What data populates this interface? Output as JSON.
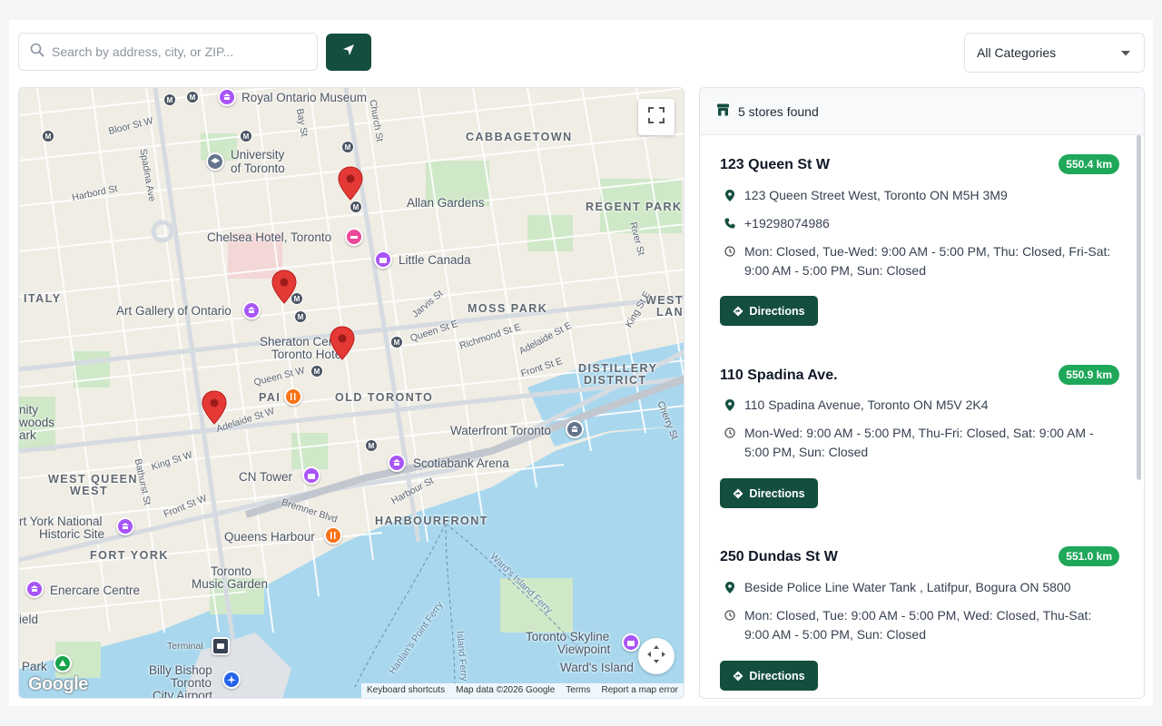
{
  "search": {
    "placeholder": "Search by address, city, or ZIP..."
  },
  "category": {
    "selected": "All Categories"
  },
  "map": {
    "labels": {
      "royal_ontario_museum": "Royal Ontario Museum",
      "university": "University",
      "of_toronto": "of Toronto",
      "cabbagetown": "CABBAGETOWN",
      "allan_gardens": "Allan Gardens",
      "regent_park": "REGENT PARK",
      "chelsea_hotel": "Chelsea Hotel, Toronto",
      "little_canada": "Little Canada",
      "italy": "ITALY",
      "art_gallery": "Art Gallery of Ontario",
      "moss_park": "MOSS PARK",
      "west_lan": "WEST",
      "west_lan2": "LAN",
      "sheraton1": "Sheraton Centre",
      "sheraton2": "Toronto Hotel",
      "distillery1": "DISTILLERY",
      "distillery2": "DISTRICT",
      "pai": "PAI",
      "old_toronto": "OLD TORONTO",
      "waterfront": "Waterfront Toronto",
      "west_queen1": "WEST QUEEN",
      "west_queen2": "WEST",
      "cn_tower": "CN Tower",
      "scotiabank": "Scotiabank Arena",
      "harbourfront": "HARBOURFRONT",
      "fort_york_nat1": "rt York National",
      "fort_york_nat2": "Historic Site",
      "fort_york": "FORT YORK",
      "queens_harbour": "Queens Harbour",
      "music_garden1": "Toronto",
      "music_garden2": "Music Garden",
      "enercare": "Enercare Centre",
      "ield": "ield",
      "park": "Park",
      "terminal": "Terminal",
      "billy_bishop1": "Billy Bishop",
      "billy_bishop2": "Toronto",
      "billy_bishop3": "City Airport",
      "skyline1": "Toronto Skyline",
      "skyline2": "Viewpoint",
      "wards_island": "Ward's Island",
      "nity": "nity",
      "woods": "woods",
      "ark": "ark",
      "bloor": "Bloor St W",
      "harbord": "Harbord St",
      "spadina_ave": "Spadina Ave",
      "bay_st": "Bay St",
      "church_st": "Church St",
      "river_st": "River St",
      "jarvis": "Jarvis St",
      "sherbourne": "Sherbourne St",
      "queen_st_e": "Queen St E",
      "richmond_st_e": "Richmond St E",
      "adelaide_st_e": "Adelaide St E",
      "king_st_e": "King St E",
      "front_st_e": "Front St E",
      "queen_st_w": "Queen St W",
      "adelaide_st_w": "Adelaide St W",
      "king_st_w": "King St W",
      "front_st_w": "Front St W",
      "bathurst": "Bathurst St",
      "bremner": "Bremner Blvd",
      "harbour_st": "Harbour St",
      "cherry_st": "Cherry St",
      "wards_ferry": "Ward's Island Ferry",
      "hanlans_ferry": "Hanlan's Point Ferry",
      "island_ferry": "Island Ferry",
      "google": "Google"
    },
    "attribution": [
      "Keyboard shortcuts",
      "Map data ©2026 Google",
      "Terms",
      "Report a map error"
    ]
  },
  "results": {
    "count_text": "5 stores found"
  },
  "stores": [
    {
      "name": "123 Queen St W",
      "distance": "550.4 km",
      "address": "123 Queen Street West, Toronto ON M5H 3M9",
      "phone": "+19298074986",
      "hours": "Mon: Closed, Tue-Wed: 9:00 AM - 5:00 PM, Thu: Closed, Fri-Sat: 9:00 AM - 5:00 PM, Sun: Closed",
      "directions_label": "Directions"
    },
    {
      "name": "110 Spadina Ave.",
      "distance": "550.9 km",
      "address": "110 Spadina Avenue, Toronto ON M5V 2K4",
      "hours": "Mon-Wed: 9:00 AM - 5:00 PM, Thu-Fri: Closed, Sat: 9:00 AM - 5:00 PM, Sun: Closed",
      "directions_label": "Directions"
    },
    {
      "name": "250 Dundas St W",
      "distance": "551.0 km",
      "address": "Beside Police Line Water Tank , Latifpur, Bogura ON 5800",
      "hours": "Mon: Closed, Tue: 9:00 AM - 5:00 PM, Wed: Closed, Thu-Sat: 9:00 AM - 5:00 PM, Sun: Closed",
      "directions_label": "Directions"
    }
  ],
  "colors": {
    "brand": "#134e3f",
    "badge": "#1fa85a",
    "pin": "#e53935"
  }
}
